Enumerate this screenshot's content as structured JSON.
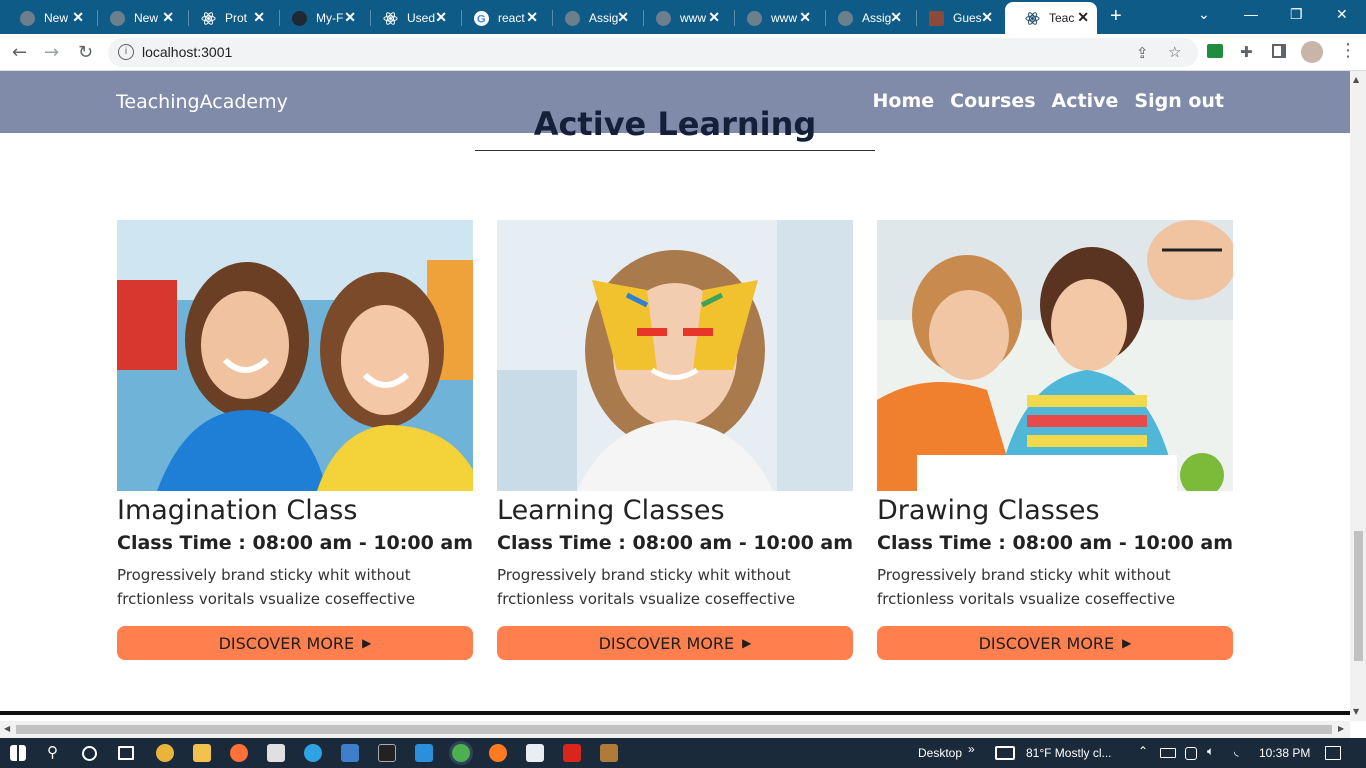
{
  "browser": {
    "tabs": [
      {
        "title": "New",
        "icon": "globe-icon"
      },
      {
        "title": "New",
        "icon": "globe-icon"
      },
      {
        "title": "Prot",
        "icon": "react-icon"
      },
      {
        "title": "My-F",
        "icon": "github-icon"
      },
      {
        "title": "Used",
        "icon": "react-icon"
      },
      {
        "title": "react",
        "icon": "google-icon"
      },
      {
        "title": "Assig",
        "icon": "globe-icon"
      },
      {
        "title": "www",
        "icon": "globe-icon"
      },
      {
        "title": "www",
        "icon": "globe-icon"
      },
      {
        "title": "Assig",
        "icon": "globe-icon"
      },
      {
        "title": "Gues",
        "icon": "image-icon"
      },
      {
        "title": "Teac",
        "icon": "react-icon"
      }
    ],
    "close_glyph": "✕",
    "new_tab_glyph": "+",
    "url": "localhost:3001",
    "info_glyph": "i"
  },
  "site": {
    "brand": "TeachingAcademy",
    "nav": {
      "home": "Home",
      "courses": "Courses",
      "active": "Active",
      "signout": "Sign out"
    },
    "section_title": "Active Learning",
    "cards": [
      {
        "title": "Imagination Class",
        "time": "Class Time : 08:00 am - 10:00 am",
        "desc": "Progressively brand sticky whit without frctionless voritals vsualize coseffective",
        "button": "DISCOVER MORE"
      },
      {
        "title": "Learning Classes",
        "time": "Class Time : 08:00 am - 10:00 am",
        "desc": "Progressively brand sticky whit without frctionless voritals vsualize coseffective",
        "button": "DISCOVER MORE"
      },
      {
        "title": "Drawing Classes",
        "time": "Class Time : 08:00 am - 10:00 am",
        "desc": "Progressively brand sticky whit without frctionless voritals vsualize coseffective",
        "button": "DISCOVER MORE"
      }
    ]
  },
  "taskbar": {
    "desktop": "Desktop",
    "chevron": "»",
    "weather": "81°F  Mostly cl...",
    "time": "10:38 PM"
  },
  "colors": {
    "navbar": "#7f8ba8",
    "button": "#ff7f4e",
    "tabbar": "#0f5b87"
  }
}
